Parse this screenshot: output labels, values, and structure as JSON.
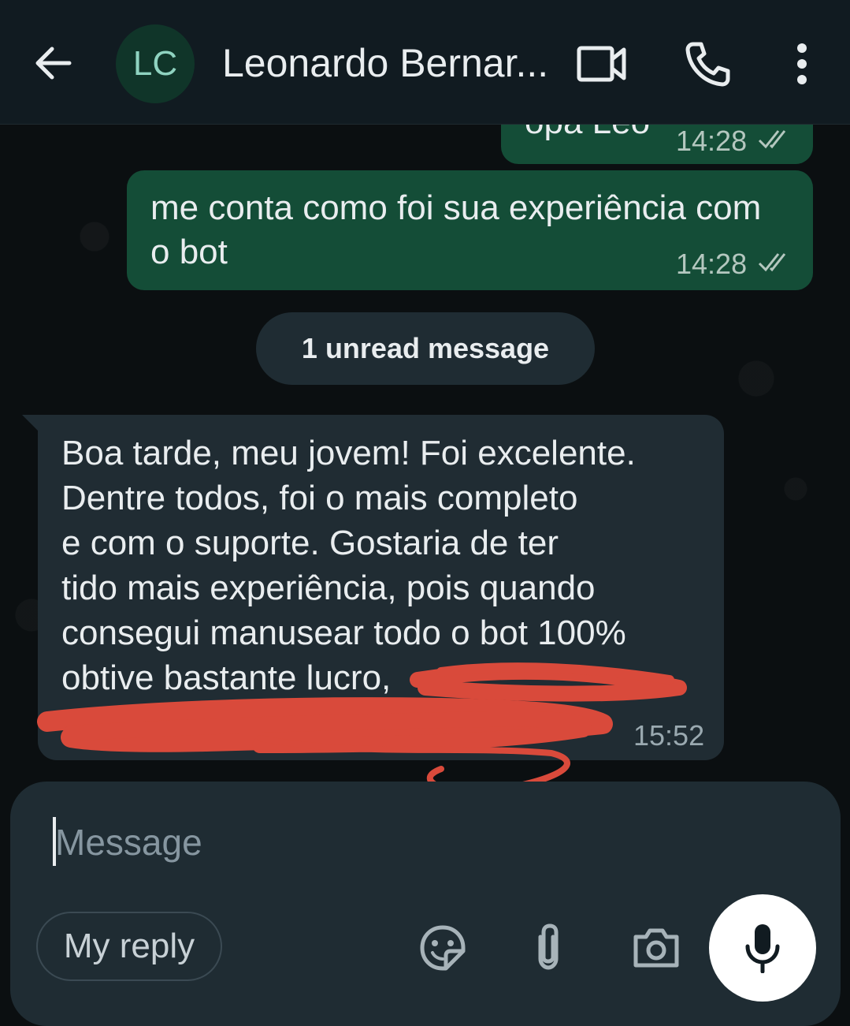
{
  "header": {
    "avatar_initials": "LC",
    "contact_name": "Leonardo Bernar...",
    "icons": [
      "back-arrow-icon",
      "video-call-icon",
      "phone-icon",
      "more-options-icon"
    ]
  },
  "messages": {
    "out_1": {
      "text": "opa Léo",
      "time": "14:28",
      "status": "read"
    },
    "out_2": {
      "text": "me conta como foi sua experiência com o bot",
      "time": "14:28",
      "status": "read"
    },
    "unread_banner": "1 unread message",
    "in_1": {
      "text": "Boa tarde, meu jovem! Foi excelente.\nDentre todos, foi o mais completo\ne com o suporte. Gostaria de ter\ntido mais experiência, pois quando\nconsegui manusear todo o bot 100%\nobtive bastante lucro,",
      "time": "15:52",
      "redacted": true
    }
  },
  "composer": {
    "placeholder": "Message",
    "reply_chip": "My reply",
    "icons": [
      "sticker-icon",
      "attach-icon",
      "camera-icon",
      "mic-icon"
    ]
  },
  "colors": {
    "header_bg": "#111b21",
    "outgoing_bubble": "#144d37",
    "incoming_bubble": "#202c33",
    "redaction": "#d94a3b"
  }
}
